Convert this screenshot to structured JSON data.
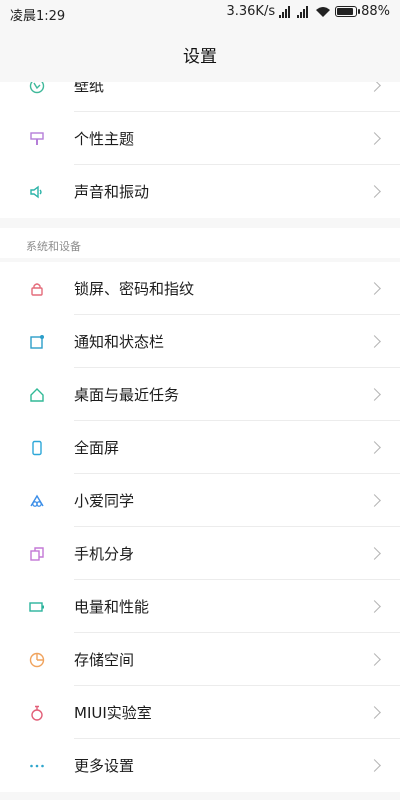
{
  "status": {
    "time": "凌晨1:29",
    "speed": "3.36K/s",
    "battery": "88%",
    "battery_level": 0.88
  },
  "header": {
    "title": "设置"
  },
  "top_group": [
    {
      "label": "壁纸",
      "icon": "wallpaper-icon",
      "color": "#3fb99a"
    },
    {
      "label": "个性主题",
      "icon": "theme-brush-icon",
      "color": "#b57ed8"
    },
    {
      "label": "声音和振动",
      "icon": "speaker-icon",
      "color": "#2bb3a8"
    }
  ],
  "system_section": {
    "title": "系统和设备",
    "items": [
      {
        "label": "锁屏、密码和指纹",
        "icon": "lock-icon",
        "color": "#e46b7a"
      },
      {
        "label": "通知和状态栏",
        "icon": "notification-icon",
        "color": "#2c9ec9"
      },
      {
        "label": "桌面与最近任务",
        "icon": "home-icon",
        "color": "#30b996"
      },
      {
        "label": "全面屏",
        "icon": "phone-icon",
        "color": "#2da7d8"
      },
      {
        "label": "小爱同学",
        "icon": "assistant-icon",
        "color": "#3c8ee8"
      },
      {
        "label": "手机分身",
        "icon": "dual-copy-icon",
        "color": "#c378d6"
      },
      {
        "label": "电量和性能",
        "icon": "battery-icon",
        "color": "#2bb39c"
      },
      {
        "label": "存储空间",
        "icon": "storage-pie-icon",
        "color": "#f0a35d"
      },
      {
        "label": "MIUI实验室",
        "icon": "flask-icon",
        "color": "#e25f78"
      },
      {
        "label": "更多设置",
        "icon": "more-dots-icon",
        "color": "#2fa6cc"
      }
    ]
  }
}
